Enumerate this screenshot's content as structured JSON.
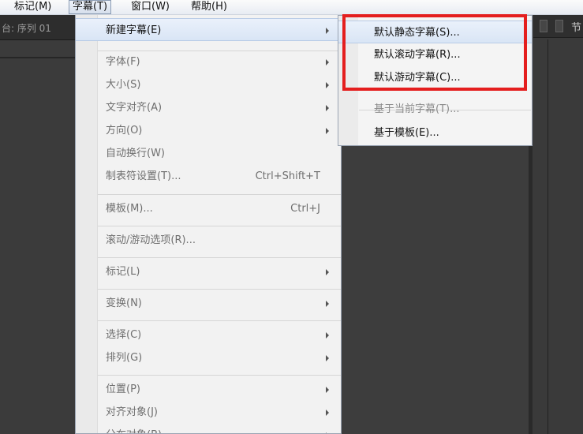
{
  "menubar": {
    "items": [
      {
        "label": "标记(M)"
      },
      {
        "label": "字幕(T)"
      },
      {
        "label": "窗口(W)"
      },
      {
        "label": "帮助(H)"
      }
    ]
  },
  "panel": {
    "title": "台: 序列 01",
    "right_label": "节"
  },
  "menu": {
    "items": [
      {
        "label": "新建字幕(E)"
      },
      {
        "label": "字体(F)"
      },
      {
        "label": "大小(S)"
      },
      {
        "label": "文字对齐(A)"
      },
      {
        "label": "方向(O)"
      },
      {
        "label": "自动换行(W)"
      },
      {
        "label": "制表符设置(T)...",
        "shortcut": "Ctrl+Shift+T"
      },
      {
        "label": "模板(M)...",
        "shortcut": "Ctrl+J"
      },
      {
        "label": "滚动/游动选项(R)..."
      },
      {
        "label": "标记(L)"
      },
      {
        "label": "变换(N)"
      },
      {
        "label": "选择(C)"
      },
      {
        "label": "排列(G)"
      },
      {
        "label": "位置(P)"
      },
      {
        "label": "对齐对象(J)"
      },
      {
        "label": "分布对象(B)"
      }
    ]
  },
  "submenu": {
    "items": [
      {
        "label": "默认静态字幕(S)..."
      },
      {
        "label": "默认滚动字幕(R)..."
      },
      {
        "label": "默认游动字幕(C)..."
      },
      {
        "label": "基于当前字幕(T)..."
      },
      {
        "label": "基于模板(E)..."
      }
    ]
  },
  "annotation": {
    "color": "#e41e1e"
  }
}
